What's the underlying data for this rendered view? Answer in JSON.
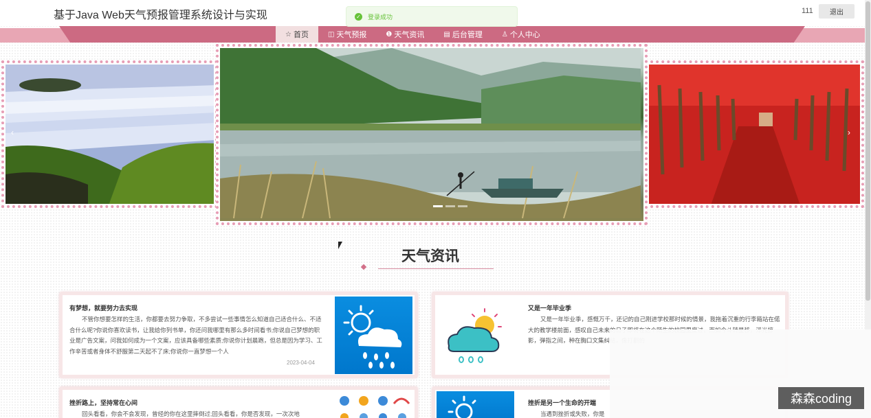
{
  "header": {
    "site_title": "基于Java Web天气预报管理系统设计与实现",
    "user_name": "111",
    "logout_label": "退出"
  },
  "toast": {
    "message": "登录成功"
  },
  "nav": {
    "items": [
      {
        "label": "首页",
        "icon": "star-icon",
        "glyph": "☆"
      },
      {
        "label": "天气预报",
        "icon": "bag-icon",
        "glyph": "◫"
      },
      {
        "label": "天气资讯",
        "icon": "info-icon",
        "glyph": "❶"
      },
      {
        "label": "后台管理",
        "icon": "briefcase-icon",
        "glyph": "▤"
      },
      {
        "label": "个人中心",
        "icon": "user-icon",
        "glyph": "♙"
      }
    ]
  },
  "carousel": {
    "prev_glyph": "‹",
    "next_glyph": "›",
    "slides": [
      "waterfall",
      "lake-with-boat",
      "red-forest"
    ],
    "active_index": 0
  },
  "section": {
    "title": "天气资讯"
  },
  "news": [
    {
      "title": "有梦想，就要努力去实现",
      "body": "不管你想要怎样的生活，你都要去努力争取，不多尝试一些事情怎么知道自己适合什么、不适合什么呢?你说你喜欢读书，让我给你列书单，你还问我哪里有那么多时间看书;你说自己梦想的职业是广告文案，问我如何成为一个文案，应该具备哪些素质;你说你计划晨跑，但总是因为学习、工作辛苦或者身体不舒服第二天起不了床;你说你一直梦想一个人",
      "date": "2023-04-04"
    },
    {
      "title": "又是一年毕业季",
      "body": "又是一年毕业季，感慨万千，还记的自己刚进学校那时候的情景，我拖着沉重的行李箱站在偌大的教学楼前面，感叹自己未来的日子即将在这个陌生的校园里度过，而如今斗转星移，浮光掠影，弹指之间，种在胸口文集纠结，像打翻的",
      "date": ""
    },
    {
      "title": "挫折路上，坚持常在心间",
      "body": "回头看看，你会不会发现，曾经的你在这里摔倒过;回头看看，你是否发现，一次次地",
      "date": ""
    },
    {
      "title": "挫折是另一个生命的开端",
      "body": "当遇到挫折或失败，你是",
      "date": ""
    }
  ],
  "watermark": {
    "text": "森森coding"
  },
  "colors": {
    "nav_bar": "#cc6a82",
    "nav_band": "#e8a6b4",
    "toast_green": "#67c23a",
    "card_border": "#f7e6e7",
    "slide_border": "#e79db5"
  }
}
